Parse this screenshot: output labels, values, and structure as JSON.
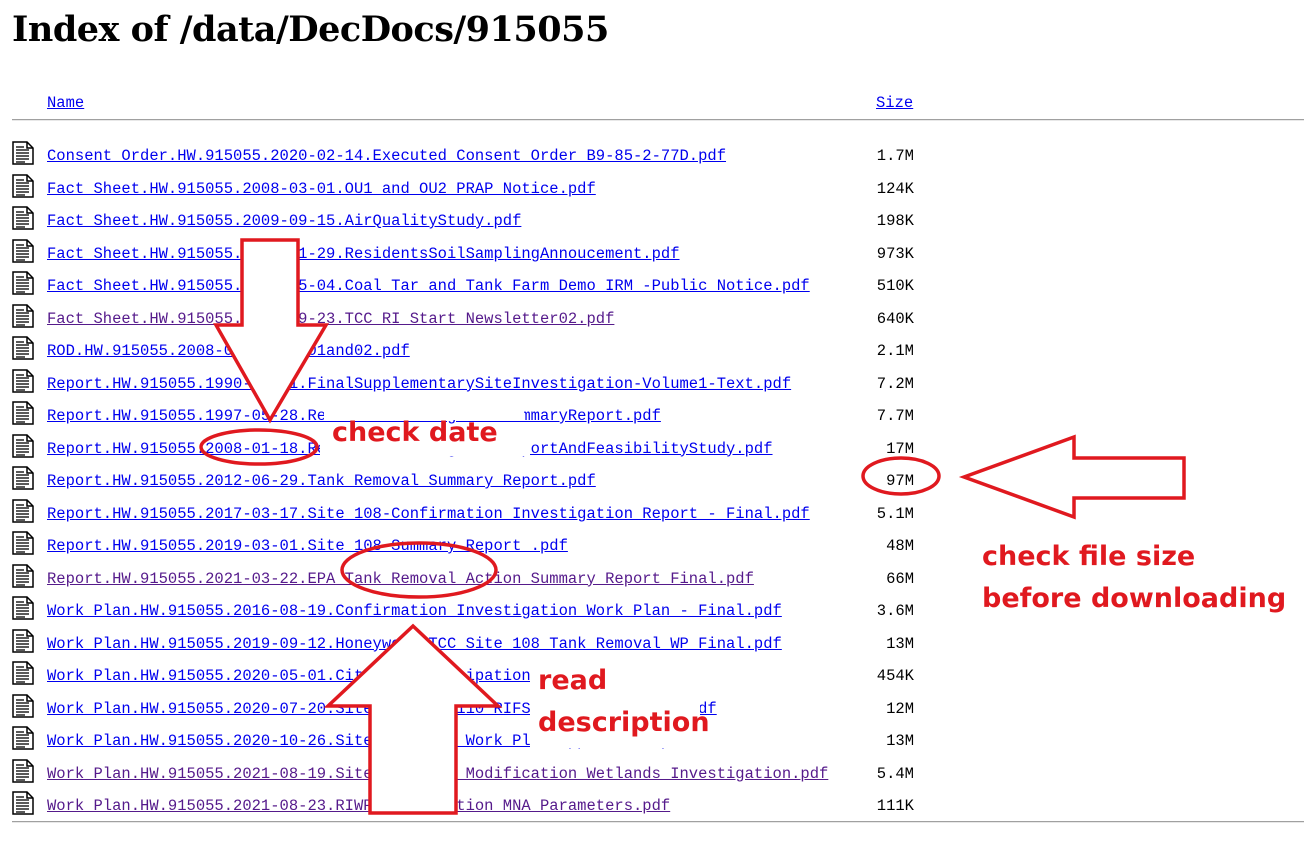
{
  "page": {
    "heading": "Index of /data/DecDocs/915055",
    "columns": {
      "name": "Name",
      "size": "Size"
    }
  },
  "files": [
    {
      "name": "Consent Order.HW.915055.2020-02-14.Executed Consent Order B9-85-2-77D.pdf",
      "size": "1.7M",
      "visited": false
    },
    {
      "name": "Fact Sheet.HW.915055.2008-03-01.OU1 and OU2 PRAP Notice.pdf",
      "size": "124K",
      "visited": false
    },
    {
      "name": "Fact Sheet.HW.915055.2009-09-15.AirQualityStudy.pdf",
      "size": "198K",
      "visited": false
    },
    {
      "name": "Fact Sheet.HW.915055.2013-01-29.ResidentsSoilSamplingAnnoucement.pdf",
      "size": "973K",
      "visited": false
    },
    {
      "name": "Fact Sheet.HW.915055.2017-05-04.Coal Tar and Tank Farm Demo IRM -Public Notice.pdf",
      "size": "510K",
      "visited": false
    },
    {
      "name": "Fact Sheet.HW.915055.2020-09-23.TCC RI Start Newsletter02.pdf",
      "size": "640K",
      "visited": true
    },
    {
      "name": "ROD.HW.915055.2008-03-31.OU-01and02.pdf",
      "size": "2.1M",
      "visited": false
    },
    {
      "name": "Report.HW.915055.1990-07-01.FinalSupplementarySiteInvestigation-Volume1-Text.pdf",
      "size": "7.2M",
      "visited": false
    },
    {
      "name": "Report.HW.915055.1997-05-28.RemedialInvestigationSummaryReport.pdf",
      "size": "7.7M",
      "visited": false
    },
    {
      "name": "Report.HW.915055.2008-01-18.RemedialInvestigationReportAndFeasibilityStudy.pdf",
      "size": "17M",
      "visited": false
    },
    {
      "name": "Report.HW.915055.2012-06-29.Tank Removal Summary Report.pdf",
      "size": "97M",
      "visited": false
    },
    {
      "name": "Report.HW.915055.2017-03-17.Site 108-Confirmation Investigation Report - Final.pdf",
      "size": "5.1M",
      "visited": false
    },
    {
      "name": "Report.HW.915055.2019-03-01.Site 108 Summary Report .pdf",
      "size": "48M",
      "visited": false
    },
    {
      "name": "Report.HW.915055.2021-03-22.EPA Tank Removal Action Summary Report Final.pdf",
      "size": "66M",
      "visited": true
    },
    {
      "name": "Work Plan.HW.915055.2016-08-19.Confirmation Investigation Work Plan - Final.pdf",
      "size": "3.6M",
      "visited": false
    },
    {
      "name": "Work Plan.HW.915055.2019-09-12.Honeywell TCC Site 108 Tank Removal WP Final.pdf",
      "size": "13M",
      "visited": false
    },
    {
      "name": "Work Plan.HW.915055.2020-05-01.Citizen Participation Plan.pdf",
      "size": "454K",
      "visited": false
    },
    {
      "name": "Work Plan.HW.915055.2020-07-20.Site 109 Site110 RIFS Work Plan Final.pdf",
      "size": "12M",
      "visited": false
    },
    {
      "name": "Work Plan.HW.915055.2020-10-26.Site 108 RIFS Work Plan Appendix A.pdf",
      "size": "13M",
      "visited": false
    },
    {
      "name": "Work Plan.HW.915055.2021-08-19.Site 108 RIWP Modification Wetlands Investigation.pdf",
      "size": "5.4M",
      "visited": true
    },
    {
      "name": "Work Plan.HW.915055.2021-08-23.RIWP Modification MNA Parameters.pdf",
      "size": "111K",
      "visited": true
    }
  ],
  "annotations": {
    "check_date": "check date",
    "check_size_line1": "check file size",
    "check_size_line2": "before downloading",
    "read_line1": "read",
    "read_line2": "description",
    "color": "#e0191f"
  },
  "icons": {
    "file": "text-file-icon",
    "arrow": "arrow-annotation-icon"
  }
}
